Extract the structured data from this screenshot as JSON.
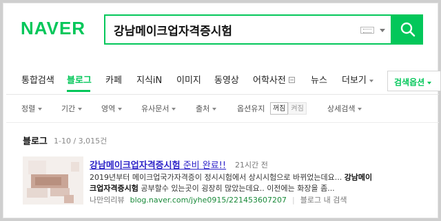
{
  "header": {
    "logo": "NAVER",
    "search_value": "강남메이크업자격증시험"
  },
  "tabs": [
    "통합검색",
    "블로그",
    "카페",
    "지식iN",
    "이미지",
    "동영상",
    "어학사전",
    "뉴스",
    "더보기"
  ],
  "options_label": "검색옵션",
  "filters": {
    "sort": "정렬",
    "period": "기간",
    "area": "영역",
    "similar": "유사문서",
    "source": "출처",
    "option_keep": "옵션유지",
    "toggle_on": "꺼짐",
    "toggle_off": "켜짐",
    "detail": "상세검색"
  },
  "section": {
    "title": "블로그",
    "count": "1-10 / 3,015건"
  },
  "result": {
    "title_keyword": "강남메이크업자격증시험",
    "title_rest": " 준비 완료!!",
    "time": "21시간 전",
    "snippet_line1": "2019년부터 메이크업국가자격증이 정시시험에서 상시시험으로 바뀌었는데요... 강남메이",
    "snippet_line1_plain": "2019년부터 메이크업국가자격증이 정시시험에서 상시시험으로 바뀌었는데요... ",
    "snippet_line1_bold": "강남메이",
    "snippet_line2_bold": "크업자격증시험",
    "snippet_line2_plain": " 공부할수 있는곳이 굉장히 많았는데요.. 이전에는 화장을 좀...",
    "blog_name": "나만의리뷰",
    "url": "blog.naver.com/jyhe0915/221453607207",
    "inner_search": "블로그 내 검색"
  },
  "colors": {
    "brand_green": "#03c75a",
    "link_blue": "#2c22c8",
    "url_green": "#1a8a3a"
  }
}
